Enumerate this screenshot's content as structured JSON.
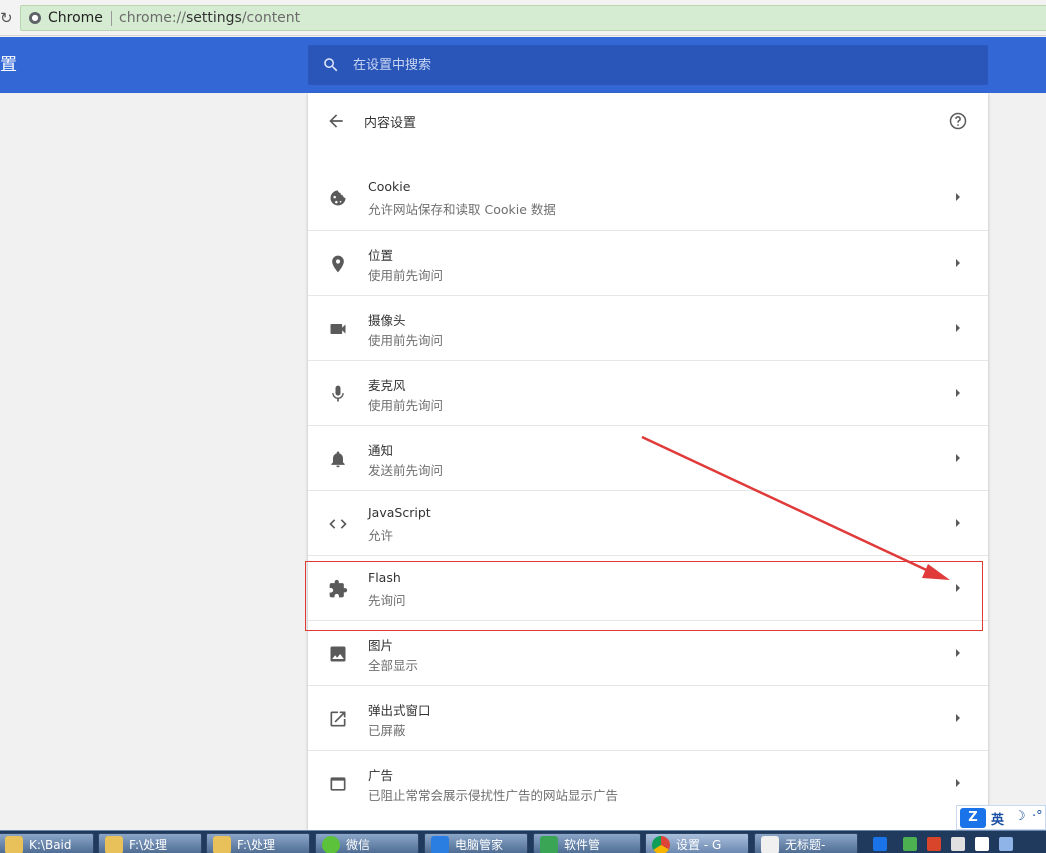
{
  "browser": {
    "omnibox_label": "Chrome",
    "url_scheme": "chrome://",
    "url_host": "settings",
    "url_path": "/content"
  },
  "header": {
    "title": "置",
    "search_placeholder": "在设置中搜索"
  },
  "page": {
    "title": "内容设置"
  },
  "rows": [
    {
      "title": "Cookie",
      "subtitle": "允许网站保存和读取 Cookie 数据",
      "icon": "cookie-icon"
    },
    {
      "title": "位置",
      "subtitle": "使用前先询问",
      "icon": "location-pin-icon"
    },
    {
      "title": "摄像头",
      "subtitle": "使用前先询问",
      "icon": "videocam-icon"
    },
    {
      "title": "麦克风",
      "subtitle": "使用前先询问",
      "icon": "mic-icon"
    },
    {
      "title": "通知",
      "subtitle": "发送前先询问",
      "icon": "bell-icon"
    },
    {
      "title": "JavaScript",
      "subtitle": "允许",
      "icon": "code-icon"
    },
    {
      "title": "Flash",
      "subtitle": "先询问",
      "icon": "puzzle-icon"
    },
    {
      "title": "图片",
      "subtitle": "全部显示",
      "icon": "image-icon"
    },
    {
      "title": "弹出式窗口",
      "subtitle": "已屏蔽",
      "icon": "open-in-new-icon"
    },
    {
      "title": "广告",
      "subtitle": "已阻止常常会展示侵扰性广告的网站显示广告",
      "icon": "web-asset-icon"
    }
  ],
  "ime": {
    "language": "英"
  },
  "taskbar": {
    "items": [
      {
        "label": "K:\\Baid",
        "icon": "folder-icon"
      },
      {
        "label": "F:\\处理",
        "icon": "folder-icon"
      },
      {
        "label": "F:\\处理",
        "icon": "folder-icon"
      },
      {
        "label": "微信",
        "icon": "wechat-icon"
      },
      {
        "label": "电脑管家",
        "icon": "pc-manager-icon"
      },
      {
        "label": "软件管",
        "icon": "software-manager-icon"
      },
      {
        "label": "设置 - G",
        "icon": "chrome-icon"
      },
      {
        "label": "无标题-",
        "icon": "notepad-icon"
      }
    ]
  },
  "colors": {
    "header_blue": "#3367d6",
    "search_blue": "#2a56b9",
    "annotation_red": "#e03a3a",
    "omnibox_green": "#d6ecd2"
  }
}
